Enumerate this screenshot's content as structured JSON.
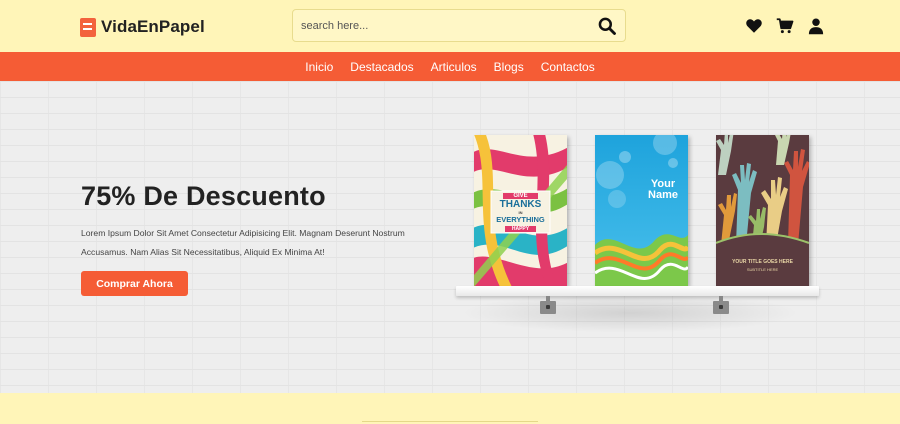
{
  "header": {
    "logo_text": "VidaEnPapel",
    "search": {
      "placeholder": "search here..."
    },
    "icons": [
      "heart-icon",
      "cart-icon",
      "user-icon"
    ]
  },
  "nav": {
    "items": [
      {
        "label": "Inicio"
      },
      {
        "label": "Destacados"
      },
      {
        "label": "Articulos"
      },
      {
        "label": "Blogs"
      },
      {
        "label": "Contactos"
      }
    ]
  },
  "hero": {
    "title": "75% De Descuento",
    "text": "Lorem Ipsum Dolor Sit Amet Consectetur Adipisicing Elit. Magnam Deserunt Nostrum Accusamus. Nam Alias Sit Necessitatibus, Aliquid Ex Minima At!",
    "cta_label": "Comprar Ahora"
  },
  "books": [
    {
      "lines": [
        "GIVE",
        "THANKS",
        "IN",
        "EVERYTHING",
        "HAPPY"
      ]
    },
    {
      "lines": [
        "Your",
        "Name"
      ]
    },
    {
      "lines": [
        "YOUR TITLE GOES HERE",
        "SUBTITLE HERE"
      ]
    }
  ],
  "colors": {
    "accent": "#f55c35",
    "header_bg": "#fff5b8",
    "text_dark": "#222222"
  }
}
